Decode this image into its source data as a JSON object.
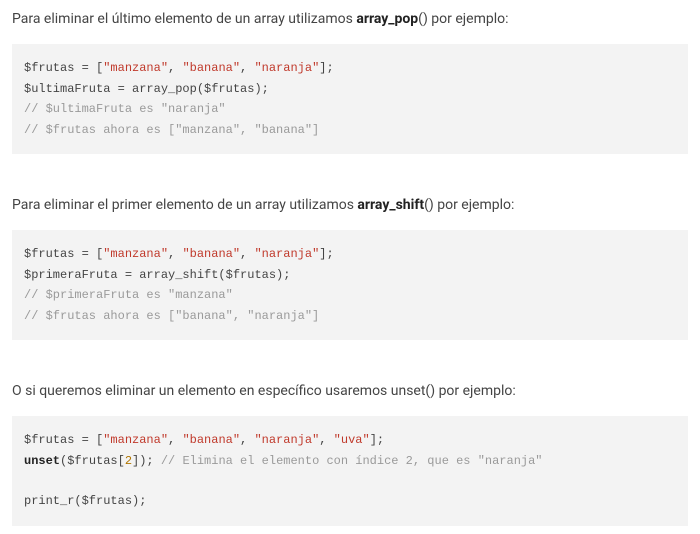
{
  "sections": [
    {
      "desc_before": "Para eliminar el último elemento de un array utilizamos ",
      "desc_bold": "array_pop",
      "desc_after": "() por ejemplo:",
      "code": [
        [
          {
            "t": "$frutas = [",
            "c": "tok-var"
          },
          {
            "t": "\"manzana\"",
            "c": "tok-str"
          },
          {
            "t": ", ",
            "c": "tok-punc"
          },
          {
            "t": "\"banana\"",
            "c": "tok-str"
          },
          {
            "t": ", ",
            "c": "tok-punc"
          },
          {
            "t": "\"naranja\"",
            "c": "tok-str"
          },
          {
            "t": "];",
            "c": "tok-punc"
          }
        ],
        [
          {
            "t": "$ultimaFruta = array_pop($frutas);",
            "c": "tok-var"
          }
        ],
        [
          {
            "t": "// $ultimaFruta es \"naranja\"",
            "c": "tok-com"
          }
        ],
        [
          {
            "t": "// $frutas ahora es [\"manzana\", \"banana\"]",
            "c": "tok-com"
          }
        ]
      ]
    },
    {
      "desc_before": "Para eliminar el primer elemento de un array utilizamos ",
      "desc_bold": "array_shift",
      "desc_after": "() por ejemplo:",
      "code": [
        [
          {
            "t": "$frutas = [",
            "c": "tok-var"
          },
          {
            "t": "\"manzana\"",
            "c": "tok-str"
          },
          {
            "t": ", ",
            "c": "tok-punc"
          },
          {
            "t": "\"banana\"",
            "c": "tok-str"
          },
          {
            "t": ", ",
            "c": "tok-punc"
          },
          {
            "t": "\"naranja\"",
            "c": "tok-str"
          },
          {
            "t": "];",
            "c": "tok-punc"
          }
        ],
        [
          {
            "t": "$primeraFruta = array_shift($frutas);",
            "c": "tok-var"
          }
        ],
        [
          {
            "t": "// $primeraFruta es \"manzana\"",
            "c": "tok-com"
          }
        ],
        [
          {
            "t": "// $frutas ahora es [\"banana\", \"naranja\"]",
            "c": "tok-com"
          }
        ]
      ]
    },
    {
      "desc_before": "O si queremos eliminar un elemento en específico usaremos unset() por ejemplo:",
      "desc_bold": "",
      "desc_after": "",
      "code": [
        [
          {
            "t": "$frutas = [",
            "c": "tok-var"
          },
          {
            "t": "\"manzana\"",
            "c": "tok-str"
          },
          {
            "t": ", ",
            "c": "tok-punc"
          },
          {
            "t": "\"banana\"",
            "c": "tok-str"
          },
          {
            "t": ", ",
            "c": "tok-punc"
          },
          {
            "t": "\"naranja\"",
            "c": "tok-str"
          },
          {
            "t": ", ",
            "c": "tok-punc"
          },
          {
            "t": "\"uva\"",
            "c": "tok-str"
          },
          {
            "t": "];",
            "c": "tok-punc"
          }
        ],
        [
          {
            "t": "unset",
            "c": "tok-kw"
          },
          {
            "t": "($frutas[",
            "c": "tok-var"
          },
          {
            "t": "2",
            "c": "tok-num"
          },
          {
            "t": "]); ",
            "c": "tok-var"
          },
          {
            "t": "// Elimina el elemento con índice 2, que es \"naranja\"",
            "c": "tok-com"
          }
        ],
        [],
        [
          {
            "t": "print_r($frutas);",
            "c": "tok-var"
          }
        ]
      ]
    }
  ]
}
